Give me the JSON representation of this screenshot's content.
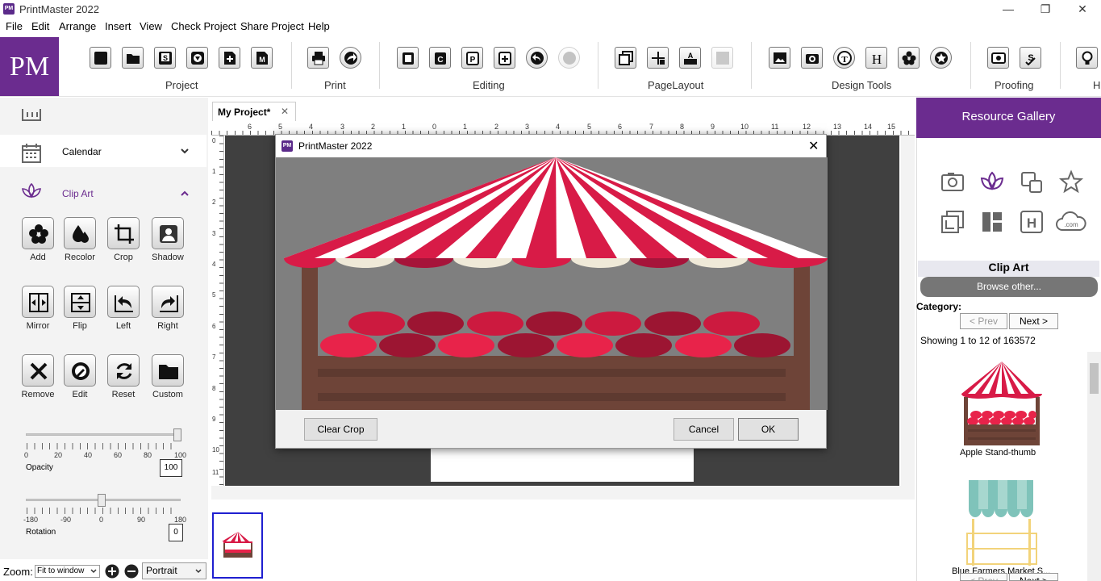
{
  "window": {
    "title": "PrintMaster 2022",
    "logo": "PM",
    "minimize": "—",
    "restore": "❐",
    "close": "✕"
  },
  "menu": [
    "File",
    "Edit",
    "Arrange",
    "Insert",
    "View",
    "Check Project",
    "Share Project",
    "Help"
  ],
  "ribbon": {
    "logo": "PM",
    "groups": [
      "Project",
      "Print",
      "Editing",
      "PageLayout",
      "Design Tools",
      "Proofing",
      "H"
    ]
  },
  "left_panel": {
    "calendar_label": "Calendar",
    "clipart_label": "Clip Art",
    "tools": [
      {
        "label": "Add",
        "icon": "flower-icon"
      },
      {
        "label": "Recolor",
        "icon": "drops-icon"
      },
      {
        "label": "Crop",
        "icon": "crop-icon"
      },
      {
        "label": "Shadow",
        "icon": "shadow-icon"
      },
      {
        "label": "Mirror",
        "icon": "mirror-icon"
      },
      {
        "label": "Flip",
        "icon": "flip-icon"
      },
      {
        "label": "Left",
        "icon": "rotate-left-icon"
      },
      {
        "label": "Right",
        "icon": "rotate-right-icon"
      },
      {
        "label": "Remove",
        "icon": "remove-icon"
      },
      {
        "label": "Edit",
        "icon": "edit-icon"
      },
      {
        "label": "Reset",
        "icon": "reset-icon"
      },
      {
        "label": "Custom",
        "icon": "folder-icon"
      }
    ],
    "opacity": {
      "label": "Opacity",
      "value": "100",
      "ticks": [
        "0",
        "20",
        "40",
        "60",
        "80",
        "100"
      ]
    },
    "rotation": {
      "label": "Rotation",
      "value": "0",
      "ticks": [
        "-180",
        "-90",
        "0",
        "90",
        "180"
      ]
    },
    "zoom": {
      "label": "Zoom:",
      "value": "Fit to window",
      "orientation": "Portrait"
    }
  },
  "document": {
    "tab_label": "My Project*",
    "tab_close": "✕",
    "ruler_h": [
      "6",
      "5",
      "4",
      "3",
      "2",
      "1",
      "0",
      "1",
      "2",
      "3",
      "4",
      "5",
      "6",
      "7",
      "8",
      "9",
      "10",
      "11",
      "12",
      "13",
      "14",
      "15"
    ],
    "ruler_v": [
      "0",
      "1",
      "2",
      "3",
      "4",
      "5",
      "6",
      "7",
      "8",
      "9",
      "10",
      "11"
    ]
  },
  "dialog": {
    "title": "PrintMaster 2022",
    "close": "✕",
    "clear_crop": "Clear Crop",
    "cancel": "Cancel",
    "ok": "OK"
  },
  "right_panel": {
    "title": "Resource Gallery",
    "section": "Clip Art",
    "browse": "Browse other...",
    "category_label": "Category:",
    "prev": "< Prev",
    "next": "Next >",
    "showing": "Showing 1 to 12 of 163572",
    "items": [
      "Apple Stand-thumb",
      "Blue Farmers Market S..."
    ]
  },
  "colors": {
    "brand": "#6b2c8f",
    "awning_red": "#d81b47",
    "apple_red": "#e8234a",
    "crate_brown": "#6e4438"
  }
}
